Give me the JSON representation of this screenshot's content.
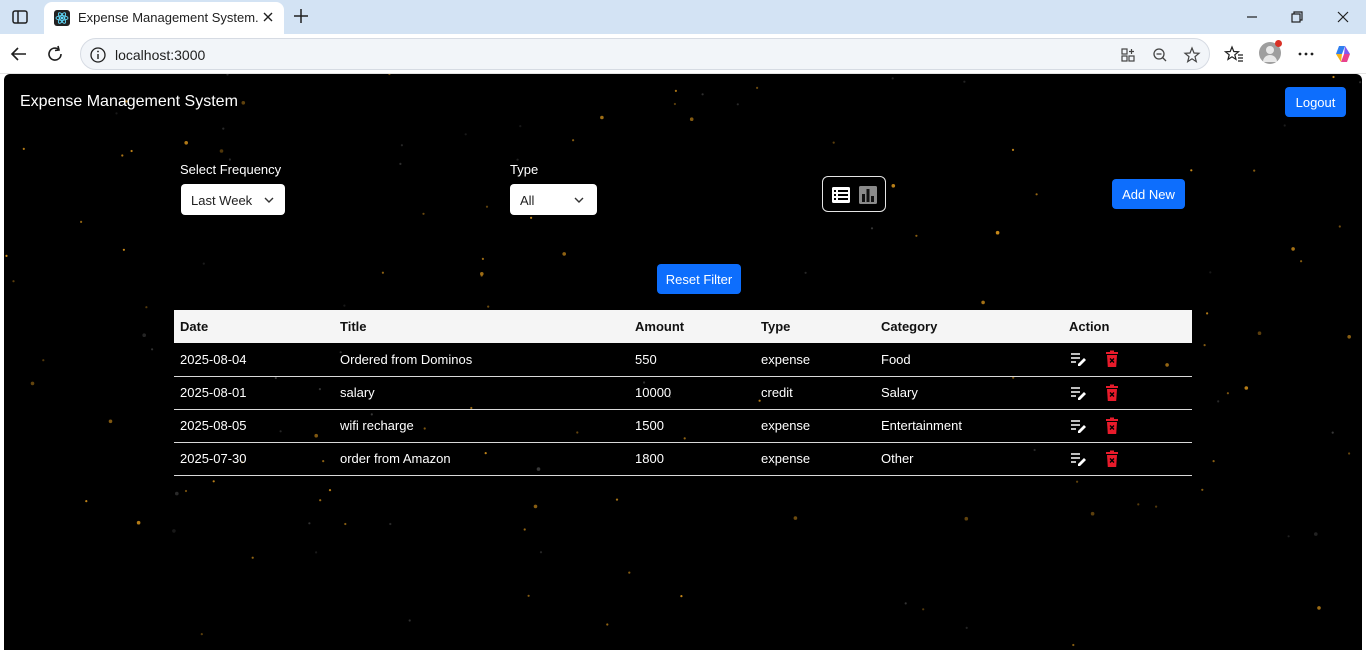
{
  "browser": {
    "tab_title": "Expense Management System.",
    "url": "localhost:3000"
  },
  "colors": {
    "accent": "#0d6efd",
    "delete": "#e81b2b",
    "star": "#c98a1a"
  },
  "app": {
    "brand": "Expense Management System",
    "logout_label": "Logout",
    "filters": {
      "frequency_label": "Select Frequency",
      "frequency_value": "Last Week",
      "type_label": "Type",
      "type_value": "All"
    },
    "add_new_label": "Add New",
    "reset_filter_label": "Reset Filter",
    "table": {
      "headers": [
        "Date",
        "Title",
        "Amount",
        "Type",
        "Category",
        "Action"
      ],
      "rows": [
        {
          "date": "2025-08-04",
          "title": "Ordered from Dominos",
          "amount": "550",
          "type": "expense",
          "category": "Food"
        },
        {
          "date": "2025-08-01",
          "title": "salary",
          "amount": "10000",
          "type": "credit",
          "category": "Salary"
        },
        {
          "date": "2025-08-05",
          "title": "wifi recharge",
          "amount": "1500",
          "type": "expense",
          "category": "Entertainment"
        },
        {
          "date": "2025-07-30",
          "title": "order from Amazon",
          "amount": "1800",
          "type": "expense",
          "category": "Other"
        }
      ]
    }
  }
}
